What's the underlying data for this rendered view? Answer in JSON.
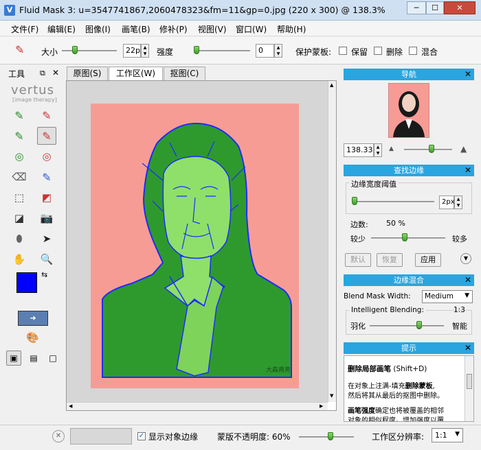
{
  "window": {
    "title": "Fluid Mask 3: u=3547741867,2060478323&fm=11&gp=0.jpg (220 x 300) @ 138.3%",
    "app_icon": "V",
    "minimize": "─",
    "maximize": "☐",
    "close": "✕"
  },
  "menu": [
    "文件(F)",
    "编辑(E)",
    "图像(I)",
    "画笔(B)",
    "修补(P)",
    "视图(V)",
    "窗口(W)",
    "帮助(H)"
  ],
  "toolbar": {
    "size_label": "大小",
    "size_value": "22px",
    "strength_label": "强度",
    "strength_value": "0",
    "protect_label": "保护蒙板:",
    "opt_keep": "保留",
    "opt_delete": "删除",
    "opt_blend": "混合"
  },
  "tools_panel": {
    "title": "工具",
    "logo": "vertus",
    "logo_sub": "[image therapy]"
  },
  "tabs": [
    "原图(S)",
    "工作区(W)",
    "抠图(C)"
  ],
  "nav": {
    "title": "导航",
    "zoom": "138.33"
  },
  "edges": {
    "title": "查找边缘",
    "threshold_label": "边缘宽度阈值",
    "threshold_value": "2px",
    "count_label": "边数:",
    "count_value": "50 %",
    "less": "较少",
    "more": "较多",
    "btn_default": "默认",
    "btn_restore": "恢复",
    "btn_apply": "应用"
  },
  "blend": {
    "title": "边缘混合",
    "width_label": "Blend Mask Width:",
    "width_value": "Medium",
    "intelligent_label": "Intelligent Blending:",
    "intelligent_value": "1:3",
    "feather": "羽化",
    "smart": "智能"
  },
  "tips": {
    "title": "提示",
    "heading": "删除局部画笔",
    "shortcut": "(Shift+D)",
    "line1a": "在对象上注满-填充",
    "line1b": "删除蒙板",
    "line1c": ",",
    "line2": "然后将其从最后的抠图中删除。",
    "line3a": "画笔强度",
    "line3b": "确定也将被覆盖的相邻",
    "line4": "对象的相似程度。增加强度以覆"
  },
  "status": {
    "show_edges": "显示对象边缘",
    "opacity_label": "蒙版不透明度: 60%",
    "resolution_label": "工作区分辨率:",
    "resolution_value": "1:1"
  },
  "canvas": {
    "watermark": "大森商务"
  },
  "colors": {
    "accent": "#2aa5e0",
    "foreground": "#0000ff",
    "background_fill": "#f79c95",
    "mask_green": "#2e9a2e",
    "edge_blue": "#1e2bff"
  }
}
